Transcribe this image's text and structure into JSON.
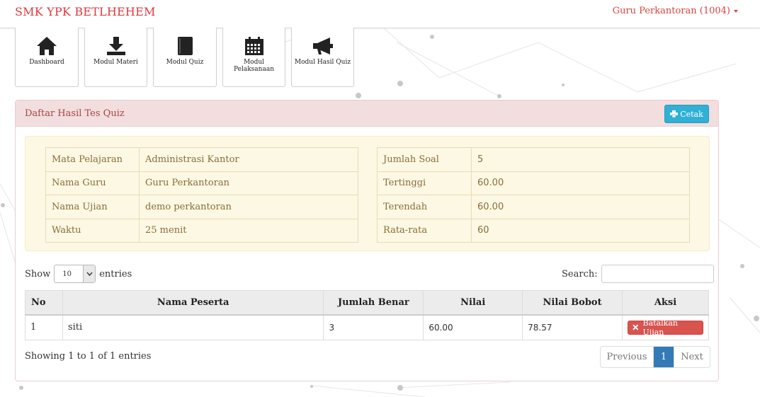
{
  "brand": "SMK YPK BETLHEHEM",
  "user_menu": "Guru Perkantoran (1004)",
  "modules": [
    {
      "label": "Dashboard",
      "icon": "home-icon"
    },
    {
      "label": "Modul Materi",
      "icon": "download-icon"
    },
    {
      "label": "Modul Quiz",
      "icon": "book-icon"
    },
    {
      "label": "Modul Pelaksanaan",
      "icon": "calendar-icon"
    },
    {
      "label": "Modul Hasil Quiz",
      "icon": "megaphone-icon"
    }
  ],
  "panel": {
    "title": "Daftar Hasil Tes Quiz",
    "print_label": "Cetak",
    "print_icon": "print-icon"
  },
  "info_left": [
    {
      "label": "Mata Pelajaran",
      "value": "Administrasi Kantor"
    },
    {
      "label": "Nama Guru",
      "value": "Guru Perkantoran"
    },
    {
      "label": "Nama Ujian",
      "value": "demo perkantoran"
    },
    {
      "label": "Waktu",
      "value": "25 menit"
    }
  ],
  "info_right": [
    {
      "label": "Jumlah Soal",
      "value": "5"
    },
    {
      "label": "Tertinggi",
      "value": "60.00"
    },
    {
      "label": "Terendah",
      "value": "60.00"
    },
    {
      "label": "Rata-rata",
      "value": "60"
    }
  ],
  "table_controls": {
    "show_label": "Show",
    "entries_value": "10",
    "entries_label": "entries",
    "search_label": "Search:",
    "search_value": ""
  },
  "table": {
    "headers": [
      "No",
      "Nama Peserta",
      "Jumlah Benar",
      "Nilai",
      "Nilai Bobot",
      "Aksi"
    ],
    "rows": [
      {
        "no": "1",
        "nama": "siti",
        "benar": "3",
        "nilai": "60.00",
        "bobot": "78.57",
        "action": "Batalkan Ujian"
      }
    ]
  },
  "footer": {
    "showing": "Showing 1 to 1 of 1 entries",
    "previous": "Previous",
    "page": "1",
    "next": "Next"
  },
  "colors": {
    "brand": "#e0373b",
    "panel_heading_bg": "#f2dede",
    "info_bg": "#fcf8e3",
    "print_button": "#31b0d5",
    "danger_button": "#d9534f",
    "pager_active": "#337ab7"
  }
}
